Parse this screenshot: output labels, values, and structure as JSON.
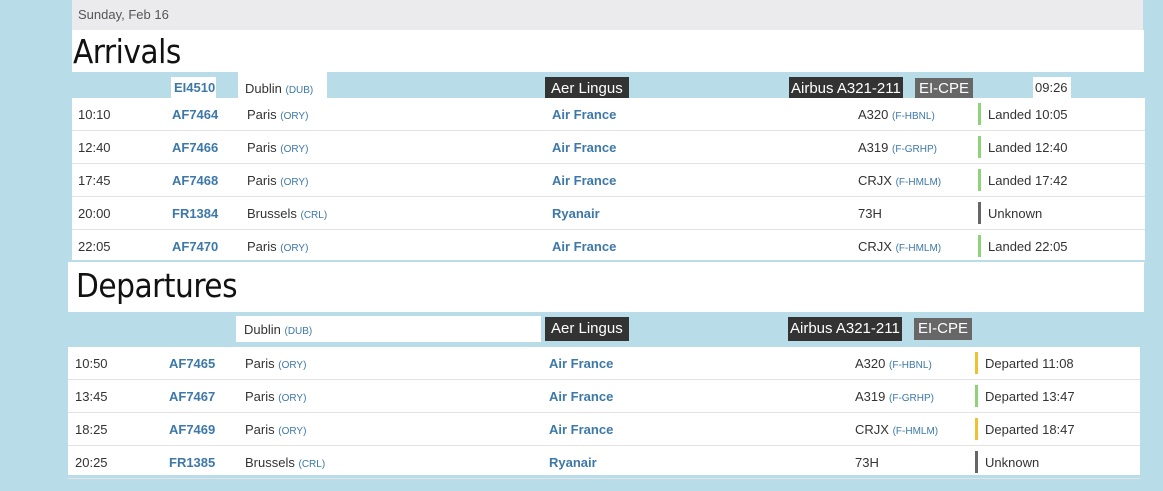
{
  "date": "Sunday, Feb 16",
  "arrivals": {
    "title": "Arrivals",
    "header": {
      "flight": "EI4510",
      "city": "Dublin",
      "city_code": "(DUB)",
      "airline": "Aer Lingus",
      "aircraft": "Airbus A321-211",
      "registration": "EI-CPE",
      "time": "09:26"
    },
    "rows": [
      {
        "time": "10:10",
        "flight": "AF7464",
        "city": "Paris",
        "code": "(ORY)",
        "airline": "Air France",
        "aircraft": "A320",
        "reg": "(F-HBNL)",
        "status": "Landed 10:05",
        "status_color": "#8ed37a"
      },
      {
        "time": "12:40",
        "flight": "AF7466",
        "city": "Paris",
        "code": "(ORY)",
        "airline": "Air France",
        "aircraft": "A319",
        "reg": "(F-GRHP)",
        "status": "Landed 12:40",
        "status_color": "#8ed37a"
      },
      {
        "time": "17:45",
        "flight": "AF7468",
        "city": "Paris",
        "code": "(ORY)",
        "airline": "Air France",
        "aircraft": "CRJX",
        "reg": "(F-HMLM)",
        "status": "Landed 17:42",
        "status_color": "#8ed37a"
      },
      {
        "time": "20:00",
        "flight": "FR1384",
        "city": "Brussels",
        "code": "(CRL)",
        "airline": "Ryanair",
        "aircraft": "73H",
        "reg": "",
        "status": "Unknown",
        "status_color": "#666666"
      },
      {
        "time": "22:05",
        "flight": "AF7470",
        "city": "Paris",
        "code": "(ORY)",
        "airline": "Air France",
        "aircraft": "CRJX",
        "reg": "(F-HMLM)",
        "status": "Landed 22:05",
        "status_color": "#8ed37a"
      }
    ]
  },
  "departures": {
    "title": "Departures",
    "header": {
      "city": "Dublin",
      "city_code": "(DUB)",
      "airline": "Aer Lingus",
      "aircraft": "Airbus A321-211",
      "registration": "EI-CPE"
    },
    "rows": [
      {
        "time": "10:50",
        "flight": "AF7465",
        "city": "Paris",
        "code": "(ORY)",
        "airline": "Air France",
        "aircraft": "A320",
        "reg": "(F-HBNL)",
        "status": "Departed 11:08",
        "status_color": "#f0c030"
      },
      {
        "time": "13:45",
        "flight": "AF7467",
        "city": "Paris",
        "code": "(ORY)",
        "airline": "Air France",
        "aircraft": "A319",
        "reg": "(F-GRHP)",
        "status": "Departed 13:47",
        "status_color": "#8ed37a"
      },
      {
        "time": "18:25",
        "flight": "AF7469",
        "city": "Paris",
        "code": "(ORY)",
        "airline": "Air France",
        "aircraft": "CRJX",
        "reg": "(F-HMLM)",
        "status": "Departed 18:47",
        "status_color": "#f0c030"
      },
      {
        "time": "20:25",
        "flight": "FR1385",
        "city": "Brussels",
        "code": "(CRL)",
        "airline": "Ryanair",
        "aircraft": "73H",
        "reg": "",
        "status": "Unknown",
        "status_color": "#666666"
      }
    ]
  }
}
